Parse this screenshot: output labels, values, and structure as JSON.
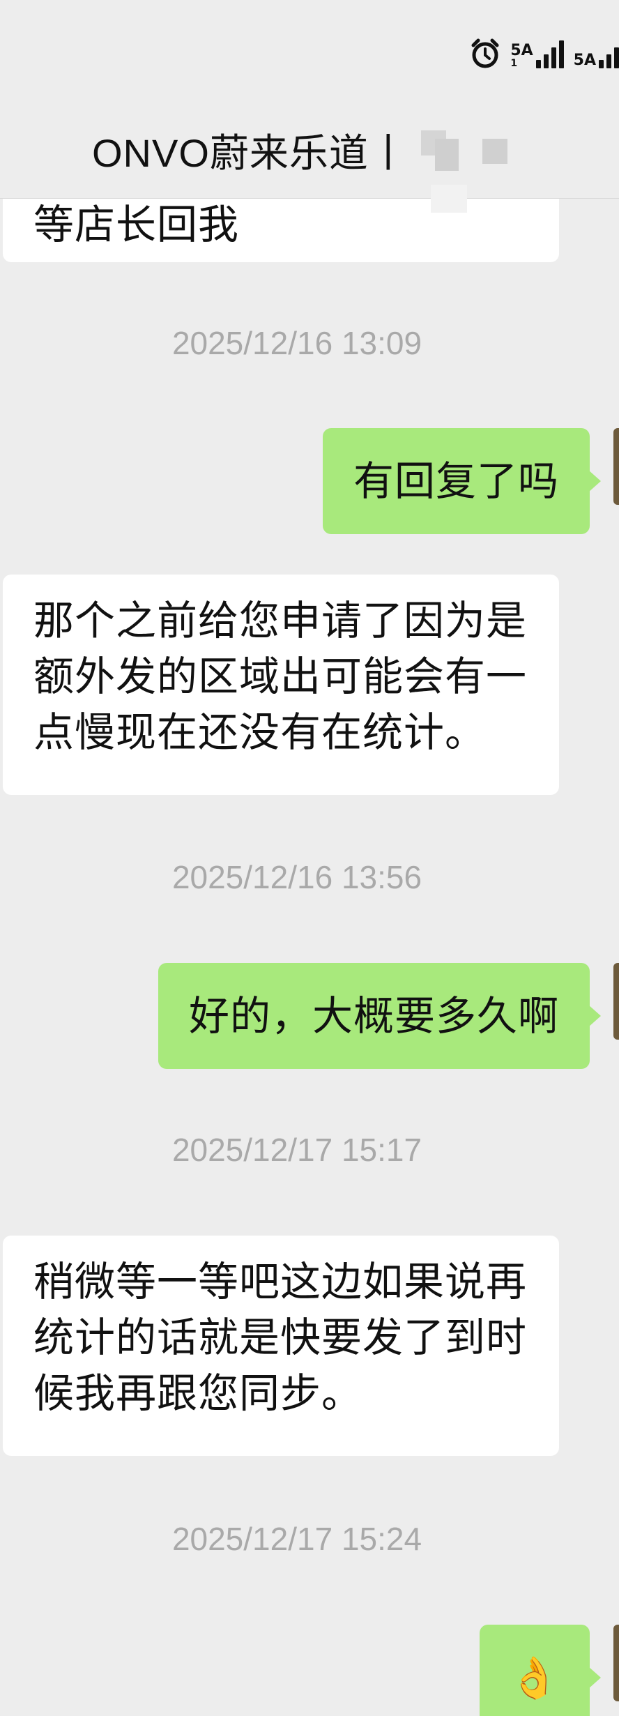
{
  "status_bar": {
    "network1": "5A",
    "network1_sub": "1",
    "network2": "5A"
  },
  "header": {
    "title": "ONVO蔚来乐道丨"
  },
  "messages": {
    "partial_incoming": "等店长回我",
    "ts1": "2025/12/16 13:09",
    "out1": "有回复了吗",
    "in1": "那个之前给您申请了因为是额外发的区域出可能会有一点慢现在还没有在统计。",
    "ts2": "2025/12/16 13:56",
    "out2": "好的，大概要多久啊",
    "ts3": "2025/12/17 15:17",
    "in2": "稍微等一等吧这边如果说再统计的话就是快要发了到时候我再跟您同步。",
    "ts4": "2025/12/17 15:24",
    "out3": "👌"
  },
  "colors": {
    "background": "#ededed",
    "outgoing_bubble": "#a8e97c",
    "incoming_bubble": "#ffffff",
    "timestamp": "#a9a9a9"
  }
}
